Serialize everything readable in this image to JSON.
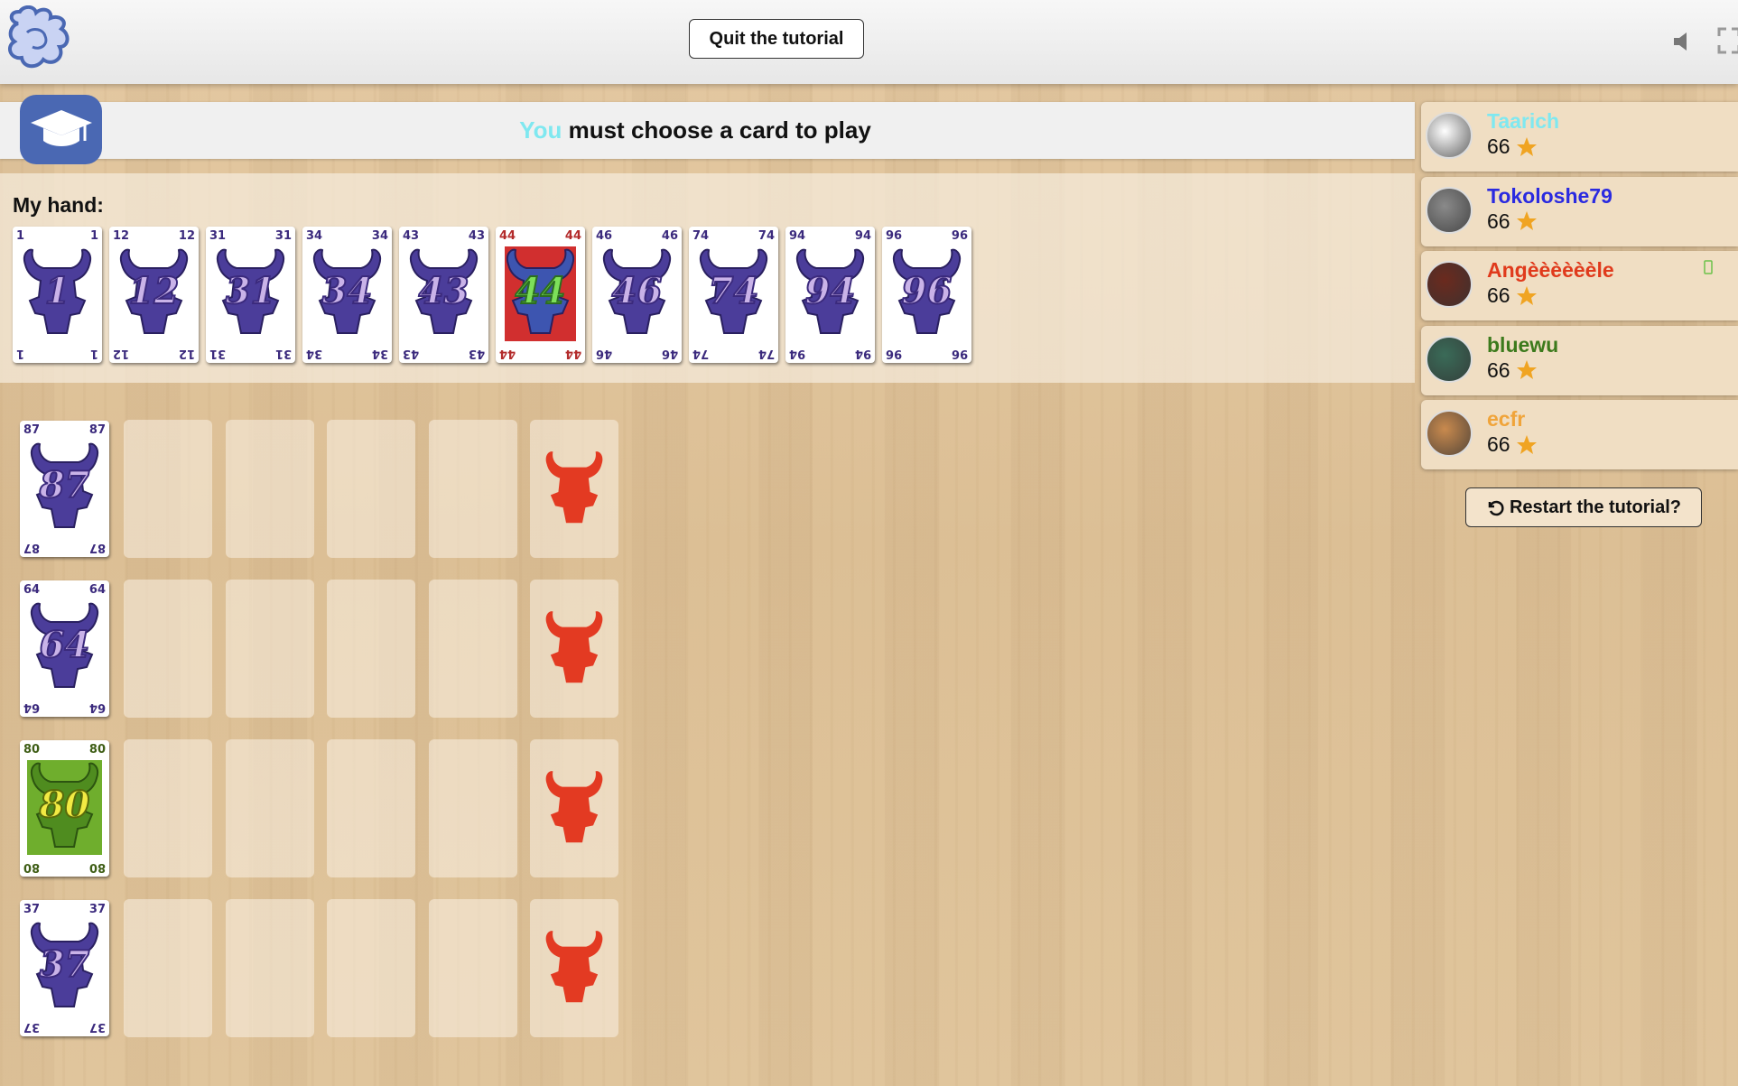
{
  "header": {
    "quit_label": "Quit the tutorial",
    "logo_icon": "game-logo-icon",
    "sound_icon": "speaker-icon",
    "fullscreen_icon": "fullscreen-icon"
  },
  "status": {
    "actor": "You",
    "message": " must choose a card to play",
    "actor_color": "#7fe8f0"
  },
  "hand": {
    "title": "My hand:",
    "cards": [
      {
        "value": "1",
        "style": "purple"
      },
      {
        "value": "12",
        "style": "purple"
      },
      {
        "value": "31",
        "style": "purple"
      },
      {
        "value": "34",
        "style": "purple"
      },
      {
        "value": "43",
        "style": "purple"
      },
      {
        "value": "44",
        "style": "red"
      },
      {
        "value": "46",
        "style": "purple"
      },
      {
        "value": "74",
        "style": "purple"
      },
      {
        "value": "94",
        "style": "purple"
      },
      {
        "value": "96",
        "style": "purple"
      }
    ]
  },
  "board": {
    "rows": [
      {
        "card": "87",
        "style": "purple"
      },
      {
        "card": "64",
        "style": "purple"
      },
      {
        "card": "80",
        "style": "green"
      },
      {
        "card": "37",
        "style": "purple"
      }
    ],
    "penalty_icon": "red-bull-icon"
  },
  "players": [
    {
      "name": "Taarich",
      "score": "66",
      "color": "#7fe8f0"
    },
    {
      "name": "Tokoloshe79",
      "score": "66",
      "color": "#2a2ae0"
    },
    {
      "name": "Angèèèèèèle",
      "score": "66",
      "color": "#e03a1c"
    },
    {
      "name": "bluewu",
      "score": "66",
      "color": "#3c7a1c"
    },
    {
      "name": "ecfr",
      "score": "66",
      "color": "#f0a43a"
    }
  ],
  "restart_label": "Restart the tutorial?"
}
